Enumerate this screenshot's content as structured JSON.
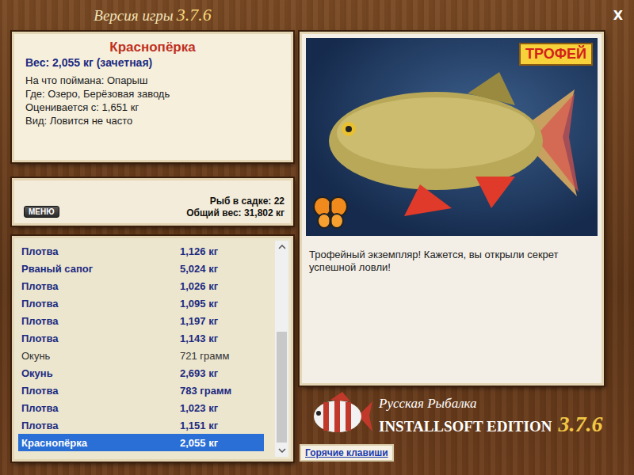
{
  "window": {
    "title": "Версия игры",
    "version": "3.7.6",
    "close": "X"
  },
  "fish": {
    "name": "Краснопёрка",
    "weight_line": "Вес: 2,055 кг (зачетная)",
    "details": [
      "На что поймана: Опарыш",
      "Где: Озеро, Берёзовая заводь",
      "Оценивается с: 1,651 кг",
      "Вид: Ловится не часто"
    ]
  },
  "menu_button": "МЕНЮ",
  "keepnet": {
    "count": "Рыб в садке: 22",
    "total": "Общий вес: 31,802 кг"
  },
  "catch_list": [
    {
      "name": "Плотва",
      "weight": "1,126 кг",
      "counted": true,
      "selected": false
    },
    {
      "name": "Рваный сапог",
      "weight": "5,024 кг",
      "counted": true,
      "selected": false
    },
    {
      "name": "Плотва",
      "weight": "1,026 кг",
      "counted": true,
      "selected": false
    },
    {
      "name": "Плотва",
      "weight": "1,095 кг",
      "counted": true,
      "selected": false
    },
    {
      "name": "Плотва",
      "weight": "1,197 кг",
      "counted": true,
      "selected": false
    },
    {
      "name": "Плотва",
      "weight": "1,143 кг",
      "counted": true,
      "selected": false
    },
    {
      "name": "Окунь",
      "weight": "721 грамм",
      "counted": false,
      "selected": false
    },
    {
      "name": "Окунь",
      "weight": "2,693 кг",
      "counted": true,
      "selected": false
    },
    {
      "name": "Плотва",
      "weight": "783 грамм",
      "counted": true,
      "selected": false
    },
    {
      "name": "Плотва",
      "weight": "1,023 кг",
      "counted": true,
      "selected": false
    },
    {
      "name": "Плотва",
      "weight": "1,151 кг",
      "counted": true,
      "selected": false
    },
    {
      "name": "Краснопёрка",
      "weight": "2,055 кг",
      "counted": true,
      "selected": true
    }
  ],
  "photo": {
    "badge": "ТРОФЕЙ"
  },
  "message": "Трофейный экземпляр! Кажется, вы открыли секрет успешной ловли!",
  "logo": {
    "title": "Русская Рыбалка",
    "edition": "INSTALLSOFT EDITION",
    "version": "3.7.6"
  },
  "hotkeys_button": "Горячие клавиши"
}
